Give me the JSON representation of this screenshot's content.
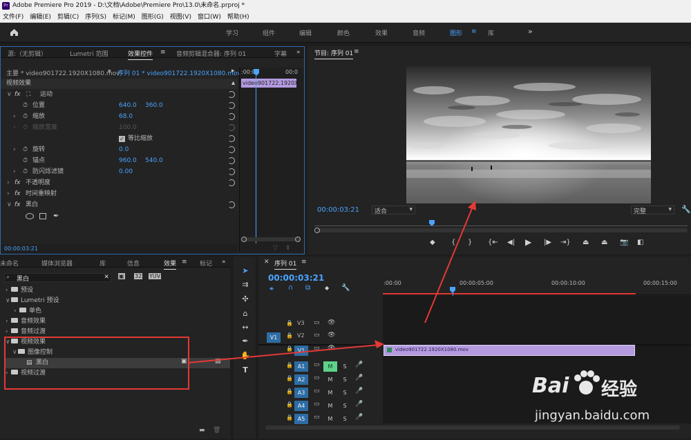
{
  "title": "Adobe Premiere Pro 2019 - D:\\文档\\Adobe\\Premiere Pro\\13.0\\未命名.prproj *",
  "menu": [
    "文件(F)",
    "编辑(E)",
    "剪辑(C)",
    "序列(S)",
    "标记(M)",
    "图形(G)",
    "视图(V)",
    "窗口(W)",
    "帮助(H)"
  ],
  "workspaces": [
    "学习",
    "组件",
    "编辑",
    "颜色",
    "效果",
    "音频",
    "图形",
    "库"
  ],
  "source_panel": {
    "tabs": [
      "源:（无剪辑）",
      "Lumetri 范围",
      "效果控件",
      "音频剪辑混合器: 序列 01",
      "字幕"
    ],
    "master_clip": "主要 * video901722.1920X1080.mov",
    "seq_clip": "序列 01 * video901722.1920X1080.mov",
    "mini_time_start": ":00:00",
    "mini_time_end": "00:0",
    "mini_clip": "video901722.1920X1",
    "section_video": "视频效果",
    "fx_motion": "运动",
    "position_label": "位置",
    "position_x": "640.0",
    "position_y": "360.0",
    "scale_label": "缩放",
    "scale_value": "68.0",
    "scale_width_label": "缩放宽度",
    "scale_width_value": "100.0",
    "uniform_scale_label": "等比缩放",
    "rotation_label": "旋转",
    "rotation_value": "0.0",
    "anchor_label": "锚点",
    "anchor_x": "960.0",
    "anchor_y": "540.0",
    "flicker_label": "防闪烁滤镜",
    "flicker_value": "0.00",
    "opacity_label": "不透明度",
    "timeremap_label": "时间重映射",
    "bw_label": "黑白",
    "timecode": "00:00:03:21"
  },
  "program_monitor": {
    "title": "节目: 序列 01",
    "timecode": "00:00:03:21",
    "fit": "适合",
    "quality": "完整"
  },
  "project_panel": {
    "tabs": [
      "未命名",
      "媒体浏览器",
      "库",
      "信息",
      "效果",
      "标记"
    ],
    "search_value": "黑白",
    "tree": [
      {
        "label": "预设",
        "level": 0,
        "open": false
      },
      {
        "label": "Lumetri 预设",
        "level": 0,
        "open": true
      },
      {
        "label": "单色",
        "level": 1,
        "open": false
      },
      {
        "label": "音频效果",
        "level": 0,
        "open": false
      },
      {
        "label": "音频过渡",
        "level": 0,
        "open": false
      },
      {
        "label": "视频效果",
        "level": 0,
        "open": true
      },
      {
        "label": "图像控制",
        "level": 1,
        "open": true
      },
      {
        "label": "黑白",
        "level": 2,
        "open": false
      },
      {
        "label": "视频过渡",
        "level": 0,
        "open": false
      }
    ]
  },
  "timeline": {
    "tab": "序列 01",
    "timecode": "00:00:03:21",
    "ruler": [
      ":00:00",
      "00:00:05:00",
      "00:00:10:00",
      "00:00:15:00"
    ],
    "clip_name": "video901722.1920X1080.mov",
    "video_tracks": [
      "V3",
      "V2",
      "V1"
    ],
    "audio_tracks": [
      "A1",
      "A2",
      "A3",
      "A4",
      "A5"
    ],
    "src_v": "V1",
    "m_label": "M",
    "s_label": "S"
  },
  "watermark": {
    "text1": "Bai",
    "text2": "经验",
    "url": "jingyan.baidu.com"
  }
}
